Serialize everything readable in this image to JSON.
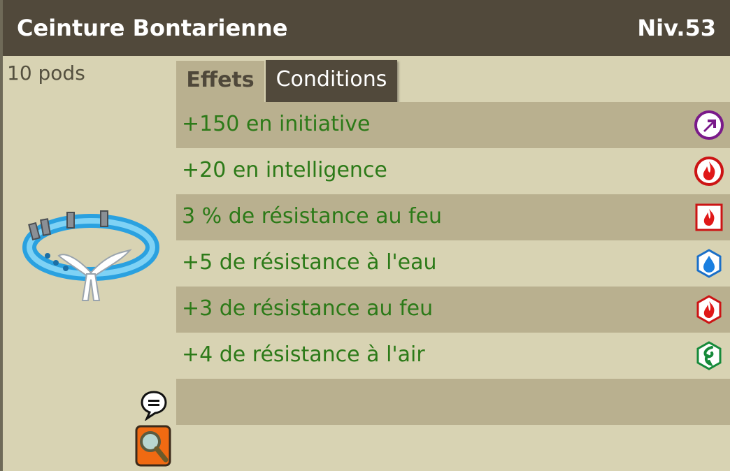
{
  "item": {
    "name": "Ceinture Bontarienne",
    "level": "Niv.53",
    "weight": "10 pods"
  },
  "tabs": {
    "effets": "Effets",
    "conditions": "Conditions"
  },
  "effects": [
    {
      "text": "+150 en initiative",
      "icon": "initiative-icon"
    },
    {
      "text": "+20 en intelligence",
      "icon": "intelligence-fire-icon"
    },
    {
      "text": "3 % de résistance au feu",
      "icon": "fire-resistance-percent-icon"
    },
    {
      "text": "+5 de résistance à l'eau",
      "icon": "water-resistance-icon"
    },
    {
      "text": "+3 de résistance au feu",
      "icon": "fire-resistance-icon"
    },
    {
      "text": "+4 de résistance à l'air",
      "icon": "air-resistance-icon"
    }
  ],
  "colors": {
    "header_bg": "#51493b",
    "effect_text": "#2c7a18",
    "row_dark": "#b9b08f",
    "row_light": "#d8d3b3"
  }
}
